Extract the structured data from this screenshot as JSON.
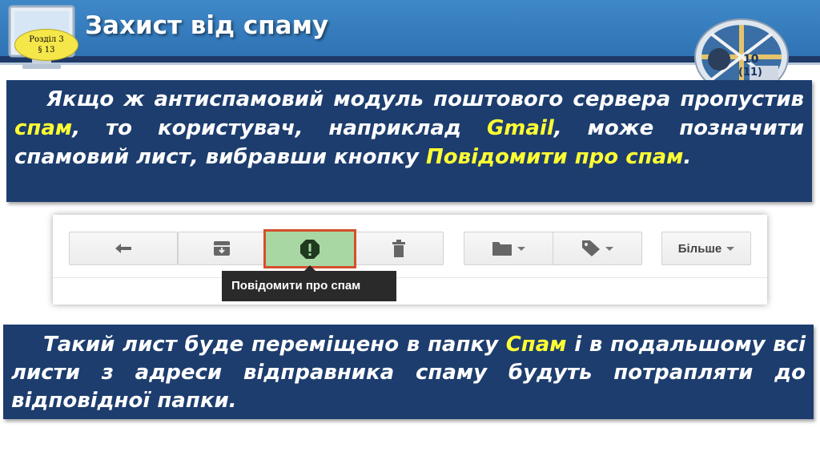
{
  "header": {
    "title": "Захист від спаму",
    "section_badge_line1": "Розділ 3",
    "section_badge_line2": "§ 13",
    "grade_logo_text_1": "10",
    "grade_logo_text_2": "(11)",
    "colors": {
      "header_blue": "#3f88c8",
      "panel_navy": "#1d3d6e",
      "highlight": "#ffff33"
    }
  },
  "panel1": {
    "text_1": "Якщо ж антиспамовий модуль поштового сервера пропустив ",
    "hl_1": "спам",
    "text_2": ", то користувач, наприклад ",
    "hl_2": "Gmail",
    "text_3": ", може позначити спамовий лист, вибравши кнопку ",
    "hl_3": "Повідомити про спам",
    "text_4": "."
  },
  "toolbar": {
    "reply_icon": "reply-arrow-icon",
    "archive_icon": "archive-icon",
    "spam_icon": "report-spam-icon",
    "delete_icon": "trash-icon",
    "move_icon": "folder-icon",
    "label_icon": "label-tag-icon",
    "more_label": "Більше",
    "tooltip": "Повідомити про спам"
  },
  "panel2": {
    "text_1": "Такий лист буде переміщено в папку ",
    "hl_1": "Спам",
    "text_2": " і в подальшому всі листи з адреси відправника спаму будуть потрапляти до відповідної папки."
  }
}
